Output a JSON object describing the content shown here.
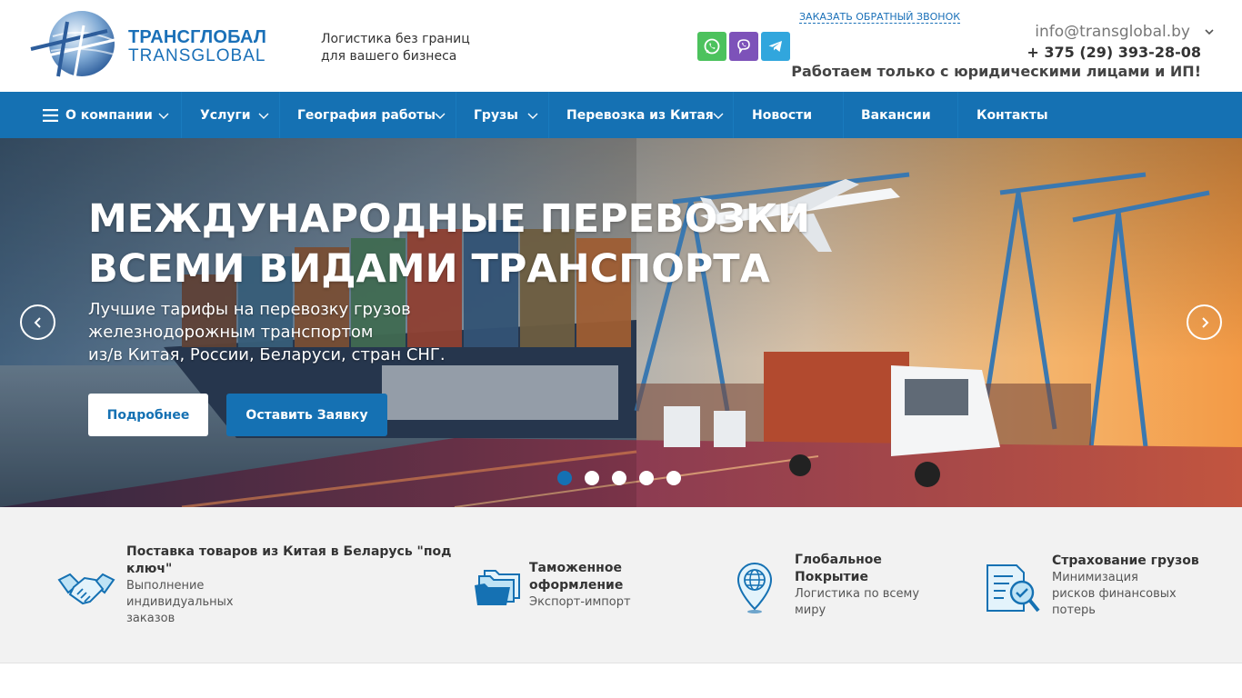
{
  "header": {
    "logo_ru": "ТРАНСГЛОБАЛ",
    "logo_en": "TRANSGLOBAL",
    "tagline_line1": "Логистика без границ",
    "tagline_line2": "для вашего бизнеса",
    "callback": "Заказать обратный звонок",
    "email": "info@transglobal.by",
    "phone": "+ 375 (29) 393-28-08",
    "notice": "Работаем только с юридическими лицами и ИП!",
    "messengers": [
      "whatsapp-icon",
      "viber-icon",
      "telegram-icon"
    ]
  },
  "nav": {
    "items": [
      {
        "label": "О компании"
      },
      {
        "label": "Услуги"
      },
      {
        "label": "География работы"
      },
      {
        "label": "Грузы"
      },
      {
        "label": "Перевозка из Китая"
      },
      {
        "label": "Новости"
      },
      {
        "label": "Вакансии"
      },
      {
        "label": "Контакты"
      }
    ]
  },
  "hero": {
    "title_line1": "МЕЖДУНАРОДНЫЕ ПЕРЕВОЗКИ",
    "title_line2": "ВСЕМИ ВИДАМИ ТРАНСПОРТА",
    "sub_line1": "Лучшие тарифы на перевозку грузов",
    "sub_line2": "железнодорожным транспортом",
    "sub_line3": "из/в Китая, России, Беларуси, стран СНГ.",
    "btn_more": "Подробнее",
    "btn_order": "Оставить Заявку",
    "slides_count": 5,
    "active_slide": 1
  },
  "features": [
    {
      "title_line1": "Поставка товаров из Китая в Беларусь \"под",
      "title_line2": "ключ\"",
      "text_line1": "Выполнение",
      "text_line2": "индивидуальных",
      "text_line3": "заказов",
      "icon": "handshake-icon"
    },
    {
      "title_line1": "Таможенное",
      "title_line2": "оформление",
      "text_line1": "Экспорт-импорт",
      "icon": "folders-icon"
    },
    {
      "title_line1": "Глобальное",
      "title_line2": "Покрытие",
      "text_line1": "Логистика по всему",
      "text_line2": "миру",
      "icon": "globe-pin-icon"
    },
    {
      "title_line1": "Страхование грузов",
      "text_line1": "Минимизация",
      "text_line2": "рисков финансовых",
      "text_line3": "потерь",
      "icon": "document-check-icon"
    }
  ],
  "colors": {
    "brand": "#1571b3",
    "whatsapp": "#4cc25d",
    "viber": "#7d52b9",
    "telegram": "#31a6dd",
    "features_bg": "#f2f2f2"
  }
}
